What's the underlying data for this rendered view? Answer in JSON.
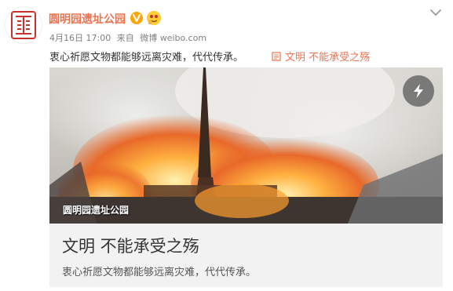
{
  "post": {
    "author": "圆明园遗址公园",
    "meta_date": "4月16日 17:00",
    "meta_from": "来自",
    "meta_source": "微博 weibo.com",
    "text": "衷心祈愿文物都能够远离灾难，代代传承。",
    "link_label": "文明 不能承受之殇"
  },
  "card": {
    "watermark": "圆明园遗址公园",
    "title": "文明 不能承受之殇",
    "description": "衷心祈愿文物都能够远离灾难，代代传承。"
  },
  "icons": {
    "verified": "verified-badge-icon",
    "emoji": "emoji-icon",
    "chevron": "chevron-down-icon",
    "link": "article-link-icon",
    "lightning": "lightning-icon"
  },
  "colors": {
    "accent": "#eb7350",
    "verified": "#ffa500",
    "logo_red": "#c8322d"
  }
}
